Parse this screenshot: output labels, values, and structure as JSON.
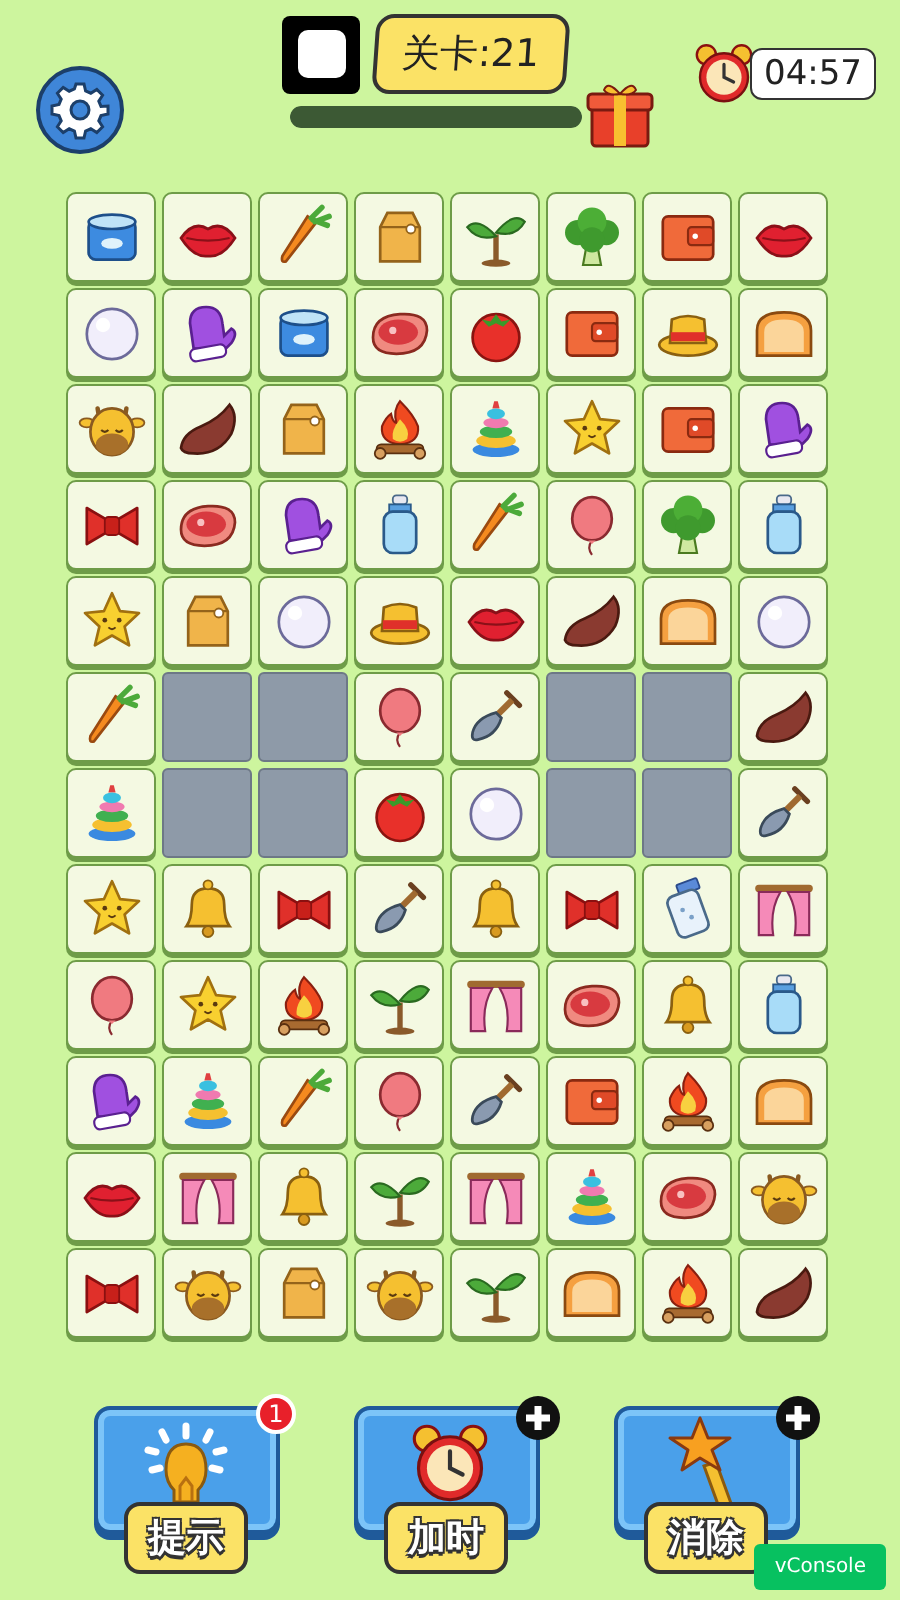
{
  "level_label": "关卡:21",
  "progress": {
    "level": 1
  },
  "timer": "04:57",
  "board": {
    "rows": [
      [
        {
          "kind": "can"
        },
        {
          "kind": "lips"
        },
        {
          "kind": "carrot"
        },
        {
          "kind": "bag"
        },
        {
          "kind": "sprout"
        },
        {
          "kind": "broccoli"
        },
        {
          "kind": "wallet"
        },
        {
          "kind": "lips"
        }
      ],
      [
        {
          "kind": "ball"
        },
        {
          "kind": "mitten"
        },
        {
          "kind": "can"
        },
        {
          "kind": "meat"
        },
        {
          "kind": "tomato"
        },
        {
          "kind": "wallet"
        },
        {
          "kind": "hat"
        },
        {
          "kind": "bread"
        }
      ],
      [
        {
          "kind": "giraffe"
        },
        {
          "kind": "potato"
        },
        {
          "kind": "bag"
        },
        {
          "kind": "fire"
        },
        {
          "kind": "rings"
        },
        {
          "kind": "star"
        },
        {
          "kind": "wallet"
        },
        {
          "kind": "mitten"
        }
      ],
      [
        {
          "kind": "bow"
        },
        {
          "kind": "meat"
        },
        {
          "kind": "mitten"
        },
        {
          "kind": "bottle"
        },
        {
          "kind": "carrot"
        },
        {
          "kind": "balloon"
        },
        {
          "kind": "broccoli"
        },
        {
          "kind": "bottle"
        }
      ],
      [
        {
          "kind": "star"
        },
        {
          "kind": "bag"
        },
        {
          "kind": "ball"
        },
        {
          "kind": "hat"
        },
        {
          "kind": "lips"
        },
        {
          "kind": "potato"
        },
        {
          "kind": "bread"
        },
        {
          "kind": "ball"
        }
      ],
      [
        {
          "kind": "carrot"
        },
        {
          "kind": "empty"
        },
        {
          "kind": "empty"
        },
        {
          "kind": "balloon"
        },
        {
          "kind": "shovel"
        },
        {
          "kind": "empty"
        },
        {
          "kind": "empty"
        },
        {
          "kind": "potato"
        }
      ],
      [
        {
          "kind": "rings"
        },
        {
          "kind": "empty"
        },
        {
          "kind": "empty"
        },
        {
          "kind": "tomato"
        },
        {
          "kind": "ball"
        },
        {
          "kind": "empty"
        },
        {
          "kind": "empty"
        },
        {
          "kind": "shovel"
        }
      ],
      [
        {
          "kind": "star"
        },
        {
          "kind": "bell"
        },
        {
          "kind": "bow"
        },
        {
          "kind": "shovel"
        },
        {
          "kind": "bell"
        },
        {
          "kind": "bow"
        },
        {
          "kind": "salt"
        },
        {
          "kind": "curtains"
        }
      ],
      [
        {
          "kind": "balloon"
        },
        {
          "kind": "star"
        },
        {
          "kind": "fire"
        },
        {
          "kind": "sprout"
        },
        {
          "kind": "curtains"
        },
        {
          "kind": "meat"
        },
        {
          "kind": "bell"
        },
        {
          "kind": "bottle"
        }
      ],
      [
        {
          "kind": "mitten"
        },
        {
          "kind": "rings"
        },
        {
          "kind": "carrot"
        },
        {
          "kind": "balloon"
        },
        {
          "kind": "shovel"
        },
        {
          "kind": "wallet"
        },
        {
          "kind": "fire"
        },
        {
          "kind": "bread"
        }
      ],
      [
        {
          "kind": "lips"
        },
        {
          "kind": "curtains"
        },
        {
          "kind": "bell"
        },
        {
          "kind": "sprout"
        },
        {
          "kind": "curtains"
        },
        {
          "kind": "rings"
        },
        {
          "kind": "meat"
        },
        {
          "kind": "giraffe"
        }
      ],
      [
        {
          "kind": "bow"
        },
        {
          "kind": "giraffe"
        },
        {
          "kind": "bag"
        },
        {
          "kind": "giraffe"
        },
        {
          "kind": "sprout"
        },
        {
          "kind": "bread"
        },
        {
          "kind": "fire"
        },
        {
          "kind": "potato"
        }
      ]
    ]
  },
  "tools": [
    {
      "kind": "hint",
      "label": "提示",
      "badge": "1",
      "plus": false
    },
    {
      "kind": "add_time",
      "label": "加时",
      "plus": true
    },
    {
      "kind": "remove",
      "label": "消除",
      "plus": true
    }
  ],
  "debug_button": "vConsole"
}
